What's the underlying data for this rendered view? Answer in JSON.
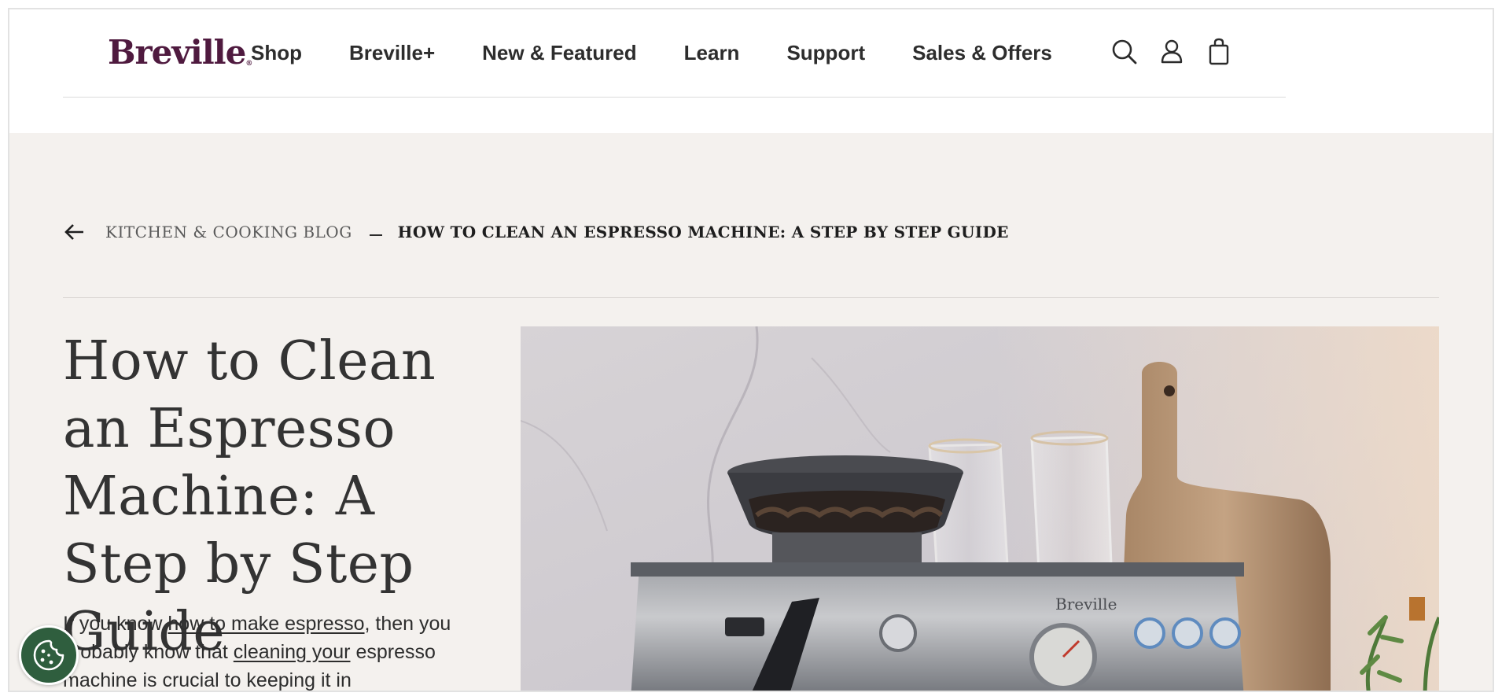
{
  "brand": {
    "logo_text": "Breville",
    "logo_mark": "®",
    "color": "#4f1a3f"
  },
  "nav": {
    "items": [
      {
        "label": "Shop"
      },
      {
        "label": "Breville+"
      },
      {
        "label": "New & Featured"
      },
      {
        "label": "Learn"
      },
      {
        "label": "Support"
      },
      {
        "label": "Sales & Offers"
      }
    ],
    "icons": [
      "search-icon",
      "account-icon",
      "cart-icon"
    ]
  },
  "breadcrumb": {
    "back_icon": "arrow-left-icon",
    "parent": "KITCHEN & COOKING BLOG",
    "current": "HOW TO CLEAN AN ESPRESSO MACHINE: A STEP BY STEP GUIDE"
  },
  "article": {
    "title": "How to Clean an Espresso Machine: A Step by Step Guide",
    "intro": {
      "p1": "If you know ",
      "link1": "how to make espresso",
      "p2": ", then you probably know that ",
      "link2": "cleaning your",
      "p3": " espresso machine is crucial to keeping it in"
    },
    "hero_image": {
      "subject": "espresso-machine-photo",
      "machine_brand": "Breville"
    }
  },
  "cookie_button": {
    "icon": "cookie-icon",
    "color": "#2f5e3e"
  },
  "colors": {
    "content_bg": "#f4f1ee",
    "text": "#2d2d2d"
  }
}
